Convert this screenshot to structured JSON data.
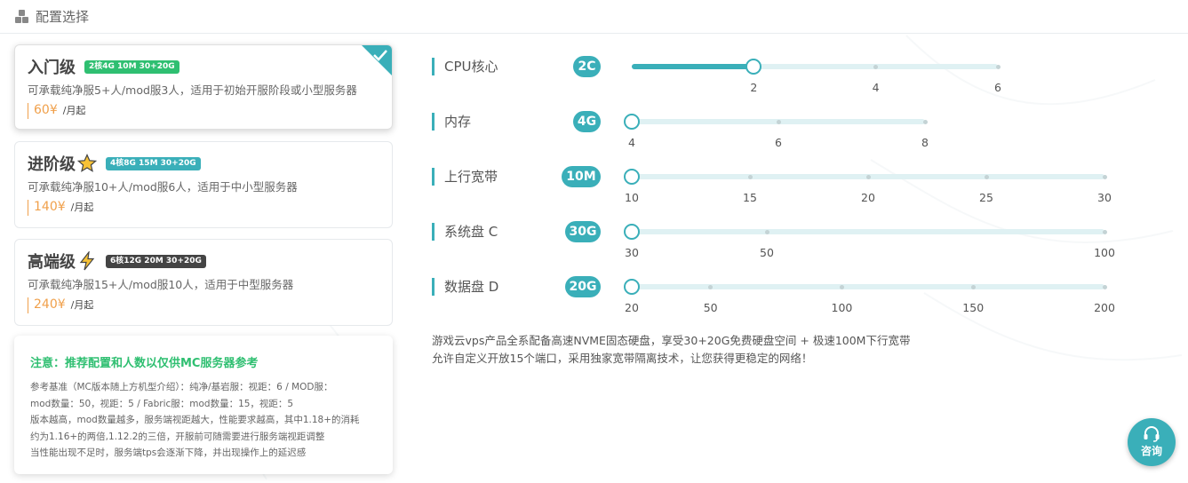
{
  "header": {
    "title": "配置选择"
  },
  "plans": [
    {
      "name": "入门级",
      "badge": "2核4G 10M 30+20G",
      "badge_color": "#2fbf71",
      "desc": "可承载纯净服5+人/mod服3人，适用于初始开服阶段或小型服务器",
      "price": "60¥",
      "unit": "/月起",
      "selected": true
    },
    {
      "name": "进阶级",
      "badge": "4核8G 15M 30+20G",
      "badge_color": "#3aafb9",
      "desc": "可承载纯净服10+人/mod服6人，适用于中小型服务器",
      "price": "140¥",
      "unit": "/月起",
      "icon": "star-icon"
    },
    {
      "name": "高端级",
      "badge": "6核12G 20M 30+20G",
      "badge_color": "#444444",
      "desc": "可承载纯净服15+人/mod服10人，适用于中型服务器",
      "price": "240¥",
      "unit": "/月起",
      "icon": "lightning-icon"
    }
  ],
  "note": {
    "title": "注意：推荐配置和人数以仅供MC服务器参考",
    "lines": [
      "参考基准（MC版本随上方机型介绍）：纯净/基岩服：视距：6 / MOD服：",
      "mod数量：50，视距：5 / Fabric服：mod数量：15，视距：5",
      "版本越高，mod数量越多，服务端视距越大，性能要求越高，其中1.18+的消耗",
      "约为1.16+的两倍,1.12.2的三倍，开服前可随需要进行服务端视距调整",
      "当性能出现不足时，服务端tps会逐渐下降，并出现操作上的延迟感"
    ]
  },
  "sliders": [
    {
      "label": "CPU核心",
      "value": "2C",
      "min": 0,
      "max": 6,
      "current": 2,
      "ticks": [
        "2",
        "4",
        "6"
      ],
      "tick_values": [
        2,
        4,
        6
      ]
    },
    {
      "label": "内存",
      "value": "4G",
      "min": 4,
      "max": 8,
      "current": 4,
      "ticks": [
        "4",
        "6",
        "8"
      ],
      "tick_values": [
        4,
        6,
        8
      ]
    },
    {
      "label": "上行宽带",
      "value": "10M",
      "min": 10,
      "max": 30,
      "current": 10,
      "ticks": [
        "10",
        "15",
        "20",
        "25",
        "30"
      ],
      "tick_values": [
        10,
        15,
        20,
        25,
        30
      ]
    },
    {
      "label": "系统盘 C",
      "value": "30G",
      "min": 30,
      "max": 100,
      "current": 30,
      "ticks": [
        "30",
        "50",
        "100"
      ],
      "tick_values": [
        30,
        50,
        100
      ]
    },
    {
      "label": "数据盘 D",
      "value": "20G",
      "min": 20,
      "max": 200,
      "current": 20,
      "ticks": [
        "20",
        "50",
        "100",
        "150",
        "200"
      ],
      "tick_values": [
        20,
        50,
        100,
        150,
        200
      ]
    }
  ],
  "info": {
    "line1": "游戏云vps产品全系配备高速NVME固态硬盘，享受30+20G免费硬盘空间 + 极速100M下行宽带",
    "line2": "允许自定义开放15个端口，采用独家宽带隔离技术，让您获得更稳定的网络！"
  },
  "consult": {
    "label": "咨询",
    "icon": "headset-icon"
  },
  "colors": {
    "accent": "#3aafb9",
    "green": "#2fbf71",
    "price": "#f0a04b"
  }
}
